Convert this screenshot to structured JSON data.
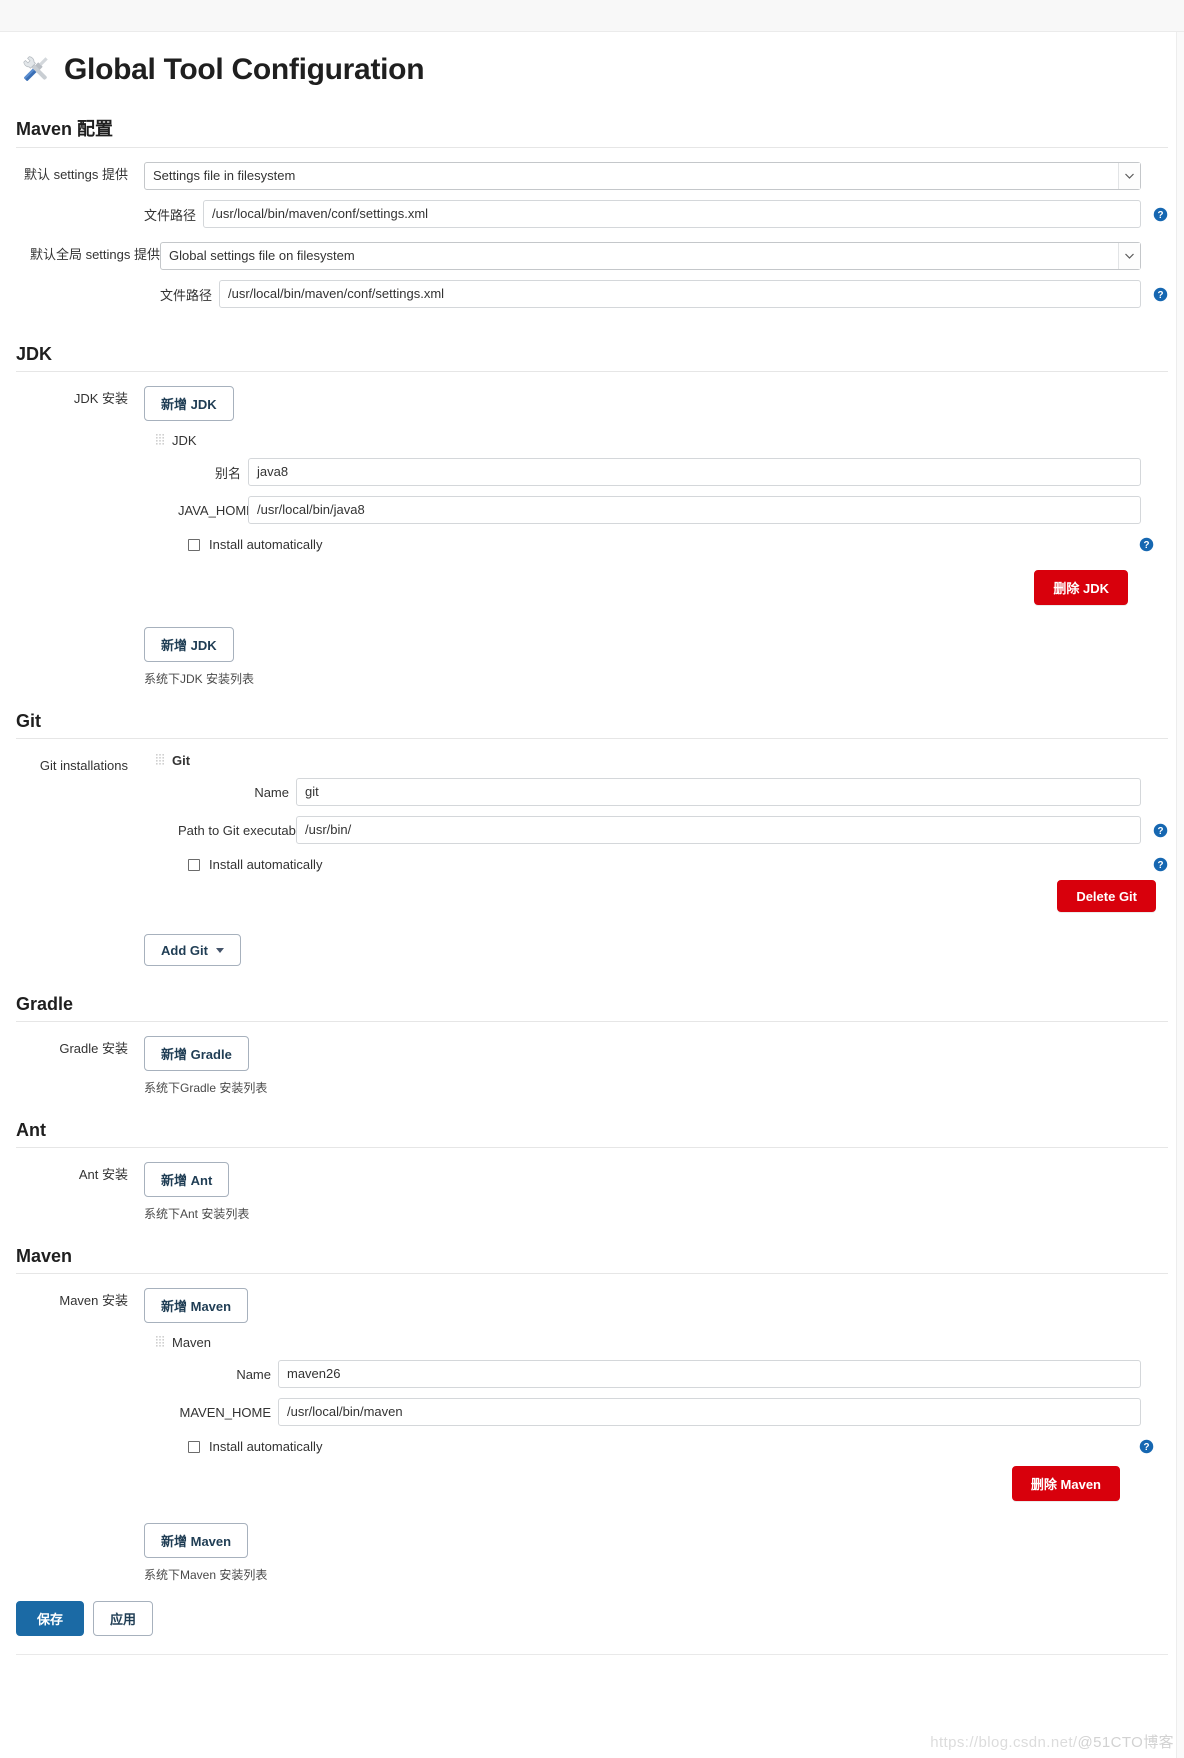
{
  "page": {
    "title": "Global Tool Configuration",
    "title_icon": "tools-icon"
  },
  "maven_config": {
    "section_title": "Maven 配置",
    "default_settings": {
      "label": "默认 settings 提供",
      "selected": "Settings file in filesystem",
      "file_path_label": "文件路径",
      "file_path_value": "/usr/local/bin/maven/conf/settings.xml",
      "help_icon": "help-icon"
    },
    "global_settings": {
      "label": "默认全局 settings 提供",
      "selected": "Global settings file on filesystem",
      "file_path_label": "文件路径",
      "file_path_value": "/usr/local/bin/maven/conf/settings.xml",
      "help_icon": "help-icon"
    }
  },
  "jdk": {
    "section_title": "JDK",
    "row_label": "JDK 安装",
    "add_button_top": "新增 JDK",
    "add_button_bottom": "新增 JDK",
    "hint": "系统下JDK 安装列表",
    "installation": {
      "heading": "JDK",
      "drag_icon": "drag-handle-icon",
      "name_label": "别名",
      "name_value": "java8",
      "home_label": "JAVA_HOME",
      "home_value": "/usr/local/bin/java8",
      "install_automatically_label": "Install automatically",
      "install_automatically_checked": false,
      "delete_button": "删除 JDK",
      "help_icon": "help-icon"
    }
  },
  "git": {
    "section_title": "Git",
    "row_label": "Git installations",
    "add_button": "Add Git",
    "add_button_caret": "chevron-down-icon",
    "installation": {
      "heading": "Git",
      "drag_icon": "drag-handle-icon",
      "name_label": "Name",
      "name_value": "git",
      "path_label": "Path to Git executable",
      "path_value": "/usr/bin/",
      "install_automatically_label": "Install automatically",
      "install_automatically_checked": false,
      "delete_button": "Delete Git",
      "help_icon_path": "help-icon",
      "help_icon_install": "help-icon"
    }
  },
  "gradle": {
    "section_title": "Gradle",
    "row_label": "Gradle 安装",
    "add_button": "新增 Gradle",
    "hint": "系统下Gradle 安装列表"
  },
  "ant": {
    "section_title": "Ant",
    "row_label": "Ant 安装",
    "add_button": "新增 Ant",
    "hint": "系统下Ant 安装列表"
  },
  "maven": {
    "section_title": "Maven",
    "row_label": "Maven 安装",
    "add_button_top": "新增 Maven",
    "add_button_bottom": "新增 Maven",
    "hint": "系统下Maven 安装列表",
    "installation": {
      "heading": "Maven",
      "drag_icon": "drag-handle-icon",
      "name_label": "Name",
      "name_value": "maven26",
      "home_label": "MAVEN_HOME",
      "home_value": "/usr/local/bin/maven",
      "install_automatically_label": "Install automatically",
      "install_automatically_checked": false,
      "delete_button": "删除 Maven",
      "help_icon": "help-icon"
    }
  },
  "footer": {
    "save_label": "保存",
    "apply_label": "应用"
  },
  "watermark": {
    "url": "https://blog.csdn.net/",
    "tag": "@51CTO博客"
  },
  "colors": {
    "danger": "#d8000c",
    "primary": "#1b6aa5",
    "help_blue": "#1667b1",
    "outline_border": "#a7b1bd"
  }
}
